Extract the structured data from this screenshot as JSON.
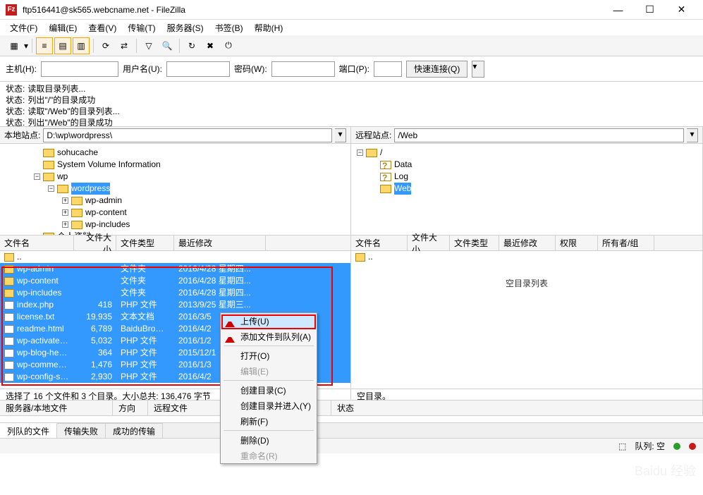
{
  "title": "ftp516441@sk565.webcname.net - FileZilla",
  "menus": [
    "文件(F)",
    "编辑(E)",
    "查看(V)",
    "传输(T)",
    "服务器(S)",
    "书签(B)",
    "帮助(H)"
  ],
  "quickconnect": {
    "host_label": "主机(H):",
    "user_label": "用户名(U):",
    "pass_label": "密码(W):",
    "port_label": "端口(P):",
    "button": "快速连接(Q)",
    "host": "",
    "user": "",
    "pass": "",
    "port": ""
  },
  "log": {
    "label": "状态:",
    "lines": [
      "读取目录列表...",
      "列出\"/\"的目录成功",
      "读取\"/Web\"的目录列表...",
      "列出\"/Web\"的目录成功"
    ]
  },
  "local": {
    "site_label": "本地站点:",
    "path": "D:\\wp\\wordpress\\",
    "tree": [
      {
        "lvl": 2,
        "exp": "",
        "label": "sohucache"
      },
      {
        "lvl": 2,
        "exp": "",
        "label": "System Volume Information"
      },
      {
        "lvl": 2,
        "exp": "−",
        "label": "wp"
      },
      {
        "lvl": 3,
        "exp": "−",
        "label": "wordpress",
        "sel": true
      },
      {
        "lvl": 4,
        "exp": "+",
        "label": "wp-admin"
      },
      {
        "lvl": 4,
        "exp": "+",
        "label": "wp-content"
      },
      {
        "lvl": 4,
        "exp": "+",
        "label": "wp-includes"
      },
      {
        "lvl": 2,
        "exp": "",
        "label": "个人资料"
      }
    ],
    "cols": [
      "文件名",
      "文件大小",
      "文件类型",
      "最近修改"
    ],
    "parent": "..",
    "files": [
      {
        "name": "wp-admin",
        "size": "",
        "type": "文件夹",
        "mod": "2016/4/28 星期四...",
        "icon": "folder"
      },
      {
        "name": "wp-content",
        "size": "",
        "type": "文件夹",
        "mod": "2016/4/28 星期四...",
        "icon": "folder"
      },
      {
        "name": "wp-includes",
        "size": "",
        "type": "文件夹",
        "mod": "2016/4/28 星期四...",
        "icon": "folder"
      },
      {
        "name": "index.php",
        "size": "418",
        "type": "PHP 文件",
        "mod": "2013/9/25 星期三...",
        "icon": "file"
      },
      {
        "name": "license.txt",
        "size": "19,935",
        "type": "文本文档",
        "mod": "2016/3/5",
        "icon": "file"
      },
      {
        "name": "readme.html",
        "size": "6,789",
        "type": "BaiduBrowse...",
        "mod": "2016/4/2",
        "icon": "file"
      },
      {
        "name": "wp-activate.php",
        "size": "5,032",
        "type": "PHP 文件",
        "mod": "2016/1/2",
        "icon": "file"
      },
      {
        "name": "wp-blog-head...",
        "size": "364",
        "type": "PHP 文件",
        "mod": "2015/12/1",
        "icon": "file"
      },
      {
        "name": "wp-comments-...",
        "size": "1,476",
        "type": "PHP 文件",
        "mod": "2016/1/3",
        "icon": "file"
      },
      {
        "name": "wp-config-sam...",
        "size": "2,930",
        "type": "PHP 文件",
        "mod": "2016/4/2",
        "icon": "file"
      }
    ],
    "status": "选择了 16 个文件和 3 个目录。大小总共: 136,476 字节"
  },
  "remote": {
    "site_label": "远程站点:",
    "path": "/Web",
    "tree": [
      {
        "lvl": 0,
        "exp": "−",
        "label": "/",
        "icon": "folder"
      },
      {
        "lvl": 1,
        "exp": "",
        "label": "Data",
        "icon": "q"
      },
      {
        "lvl": 1,
        "exp": "",
        "label": "Log",
        "icon": "q"
      },
      {
        "lvl": 1,
        "exp": "",
        "label": "Web",
        "icon": "folder",
        "sel": true
      }
    ],
    "cols": [
      "文件名",
      "文件大小",
      "文件类型",
      "最近修改",
      "权限",
      "所有者/组"
    ],
    "parent": "..",
    "empty": "空目录列表",
    "status": "空目录。"
  },
  "context": [
    {
      "label": "上传(U)",
      "icon": "up",
      "hl": true
    },
    {
      "label": "添加文件到队列(A)",
      "icon": "up"
    },
    {
      "sep": true
    },
    {
      "label": "打开(O)"
    },
    {
      "label": "编辑(E)",
      "disabled": true
    },
    {
      "sep": true
    },
    {
      "label": "创建目录(C)"
    },
    {
      "label": "创建目录并进入(Y)"
    },
    {
      "label": "刷新(F)"
    },
    {
      "sep": true
    },
    {
      "label": "删除(D)"
    },
    {
      "label": "重命名(R)",
      "disabled": true
    }
  ],
  "transfer": {
    "cols": [
      "服务器/本地文件",
      "方向",
      "远程文件"
    ],
    "remote_label": "状态"
  },
  "tabs": [
    "列队的文件",
    "传输失败",
    "成功的传输"
  ],
  "bottom": {
    "queue": "队列: 空"
  },
  "watermark": "Baidu 经验"
}
